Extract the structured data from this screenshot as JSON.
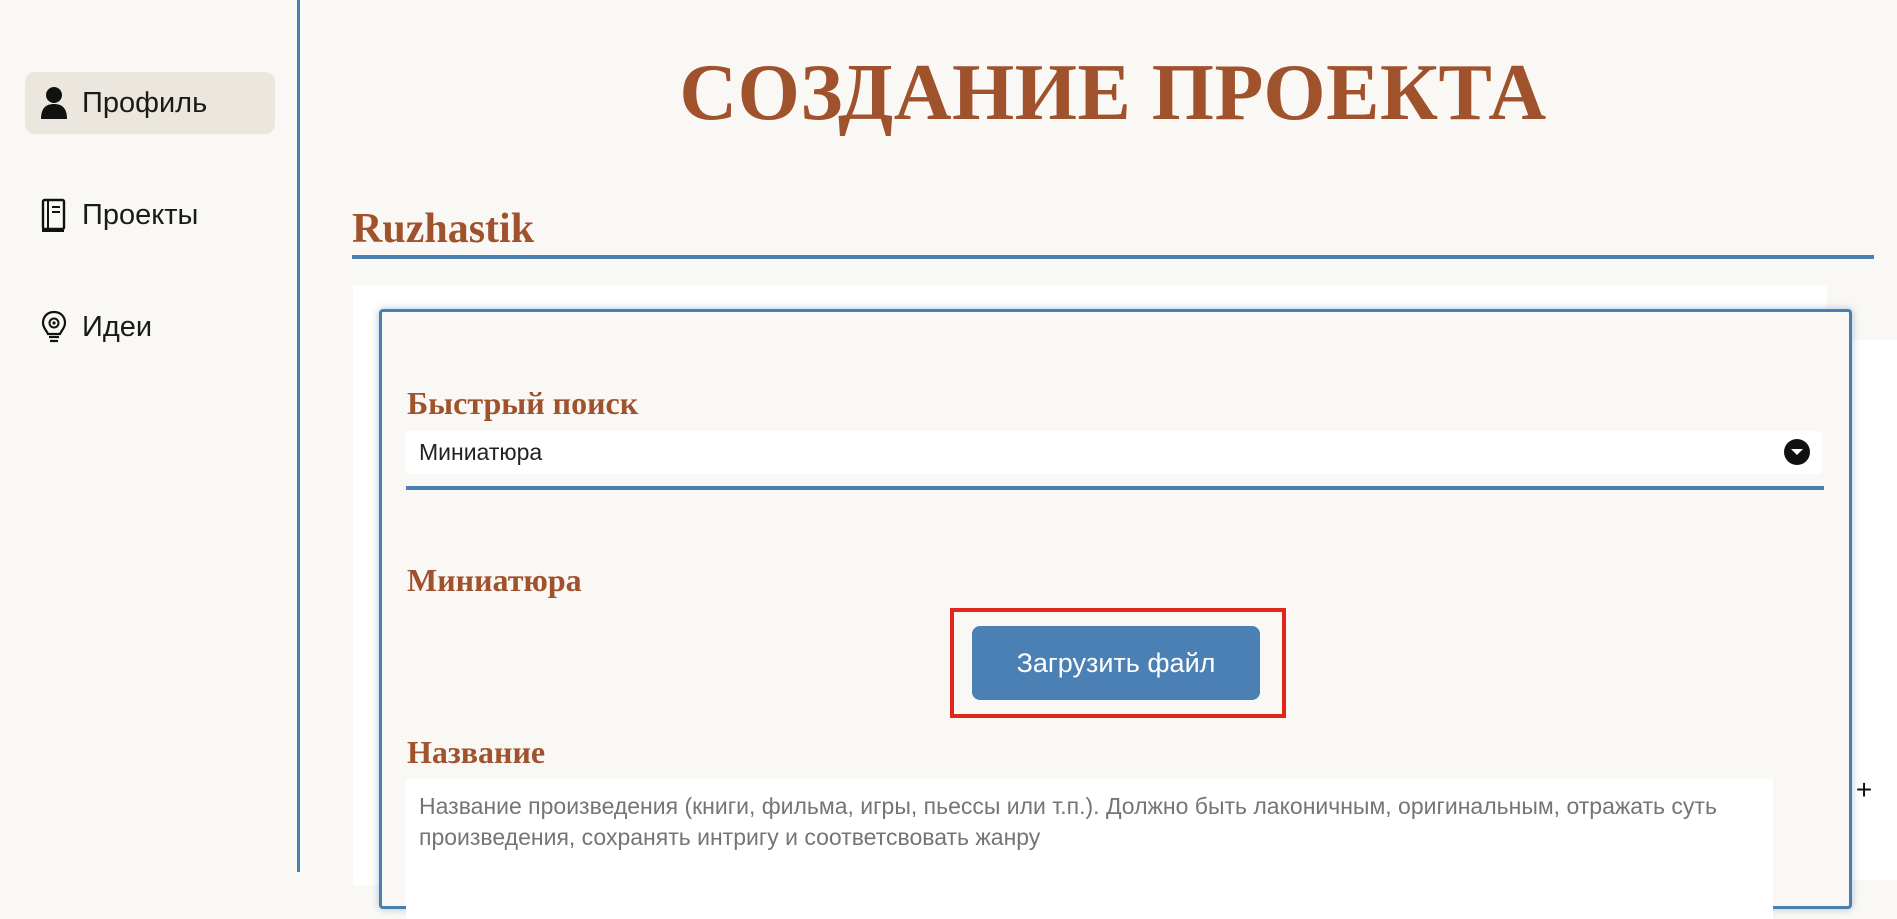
{
  "sidebar": {
    "items": [
      {
        "label": "Профиль",
        "icon": "user-icon",
        "active": true
      },
      {
        "label": "Проекты",
        "icon": "book-icon",
        "active": false
      },
      {
        "label": "Идеи",
        "icon": "lightbulb-icon",
        "active": false
      }
    ]
  },
  "page": {
    "title": "СОЗДАНИЕ ПРОЕКТА",
    "username": "Ruzhastik"
  },
  "form": {
    "quick_search_label": "Быстрый поиск",
    "quick_search_value": "Миниатюра",
    "thumbnail_label": "Миниатюра",
    "upload_button": "Загрузить файл",
    "name_label": "Название",
    "name_placeholder": "Название произведения (книги, фильма, игры, пьессы или т.п.). Должно быть лаконичным, оригинальным, отражать суть произведения, сохранять интригу и соответсвовать жанру",
    "add_symbol": "+"
  },
  "colors": {
    "accent": "#a0522d",
    "primary": "#4a7fb0",
    "highlight": "#e3261b",
    "background": "#faf8f5"
  }
}
